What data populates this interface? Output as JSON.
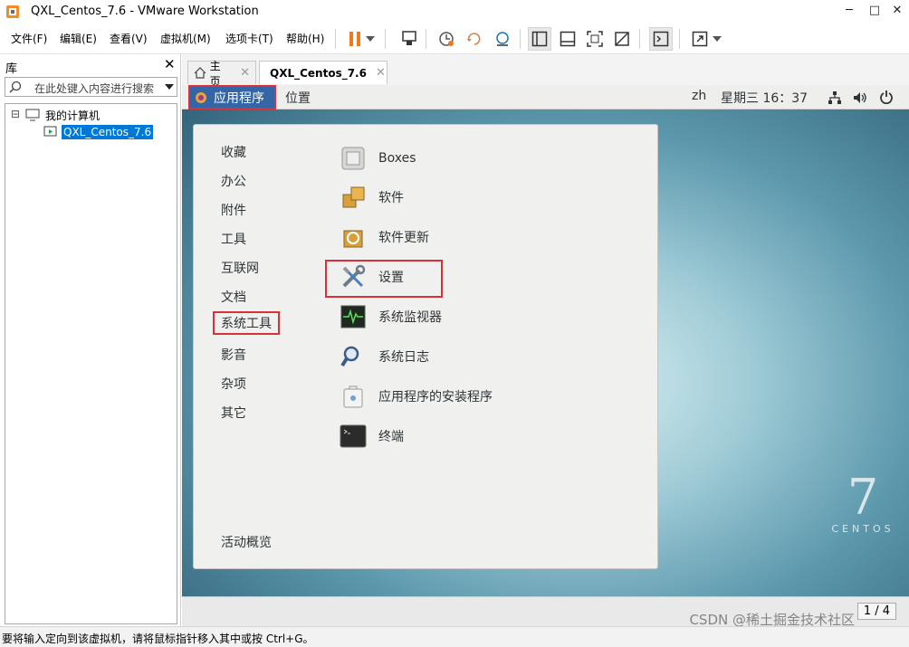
{
  "window": {
    "title": "QXL_Centos_7.6 - VMware Workstation",
    "minimize": "─",
    "maximize": "□",
    "close": "✕"
  },
  "menubar": {
    "items": [
      "文件(F)",
      "编辑(E)",
      "查看(V)",
      "虚拟机(M)",
      "选项卡(T)",
      "帮助(H)"
    ]
  },
  "toolbar": {
    "icons": [
      "pause-icon",
      "dropdown-icon",
      "send-ctrl-alt-del-icon",
      "snapshot-icon",
      "revert-snapshot-icon",
      "snapshot-manager-icon",
      "library-view-icon",
      "thumbnail-view-icon",
      "fit-guest-icon",
      "no-stretch-icon",
      "console-icon",
      "fullscreen-icon",
      "dropdown-icon"
    ],
    "pause_color": "#f07a1a"
  },
  "library": {
    "title": "库",
    "close": "✕",
    "search_placeholder": "在此处键入内容进行搜索",
    "tree": {
      "root_toggle": "⊟",
      "root_label": "我的计算机",
      "vm_label": "QXL_Centos_7.6"
    },
    "selected_color": "#0078d7"
  },
  "tabs": [
    {
      "label": "主页",
      "close": "✕",
      "active": false
    },
    {
      "label": "QXL_Centos_7.6",
      "close": "✕",
      "active": true
    }
  ],
  "guest": {
    "topbar": {
      "apps_menu": "应用程序",
      "places_menu": "位置",
      "lang": "zh",
      "clock": "星期三 16：37"
    },
    "categories": [
      "收藏",
      "办公",
      "附件",
      "工具",
      "互联网",
      "文档",
      "系统工具",
      "影音",
      "杂项",
      "其它"
    ],
    "selected_category": "系统工具",
    "apps": [
      {
        "label": "Boxes",
        "icon": "boxes-icon"
      },
      {
        "label": "软件",
        "icon": "software-icon"
      },
      {
        "label": "软件更新",
        "icon": "software-update-icon"
      },
      {
        "label": "设置",
        "icon": "settings-icon"
      },
      {
        "label": "系统监视器",
        "icon": "system-monitor-icon"
      },
      {
        "label": "系统日志",
        "icon": "system-log-icon"
      },
      {
        "label": "应用程序的安装程序",
        "icon": "app-installer-icon"
      },
      {
        "label": "终端",
        "icon": "terminal-icon"
      }
    ],
    "activities": "活动概览",
    "centos_logo": {
      "number": "7",
      "word": "CENTOS"
    },
    "page_indicator": "1 / 4",
    "watermark": "CSDN @稀土掘金技术社区",
    "highlight_color": "#d9303a",
    "topbar_accent": "#3465a4"
  },
  "statusbar": {
    "text": "要将输入定向到该虚拟机，请将鼠标指针移入其中或按 Ctrl+G。"
  }
}
